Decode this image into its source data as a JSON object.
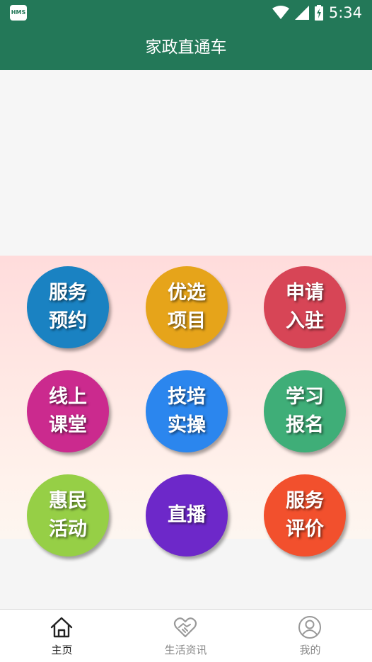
{
  "status_bar": {
    "badge": "HMS",
    "time": "5:34"
  },
  "app_bar": {
    "title": "家政直通车"
  },
  "tiles": [
    {
      "label": "服务\n预约",
      "color": "#1a82c2"
    },
    {
      "label": "优选\n项目",
      "color": "#e6a41a"
    },
    {
      "label": "申请\n入驻",
      "color": "#d74556"
    },
    {
      "label": "线上\n课堂",
      "color": "#cb2a8e"
    },
    {
      "label": "技培\n实操",
      "color": "#2b86ee"
    },
    {
      "label": "学习\n报名",
      "color": "#3fae78"
    },
    {
      "label": "惠民\n活动",
      "color": "#96cf46"
    },
    {
      "label": "直播",
      "color": "#6d28c9"
    },
    {
      "label": "服务\n评价",
      "color": "#f2502d"
    }
  ],
  "bottom_nav": {
    "items": [
      {
        "label": "主页",
        "icon": "home-icon",
        "active": true
      },
      {
        "label": "生活资讯",
        "icon": "heart-handshake-icon",
        "active": false
      },
      {
        "label": "我的",
        "icon": "person-icon",
        "active": false
      }
    ]
  }
}
